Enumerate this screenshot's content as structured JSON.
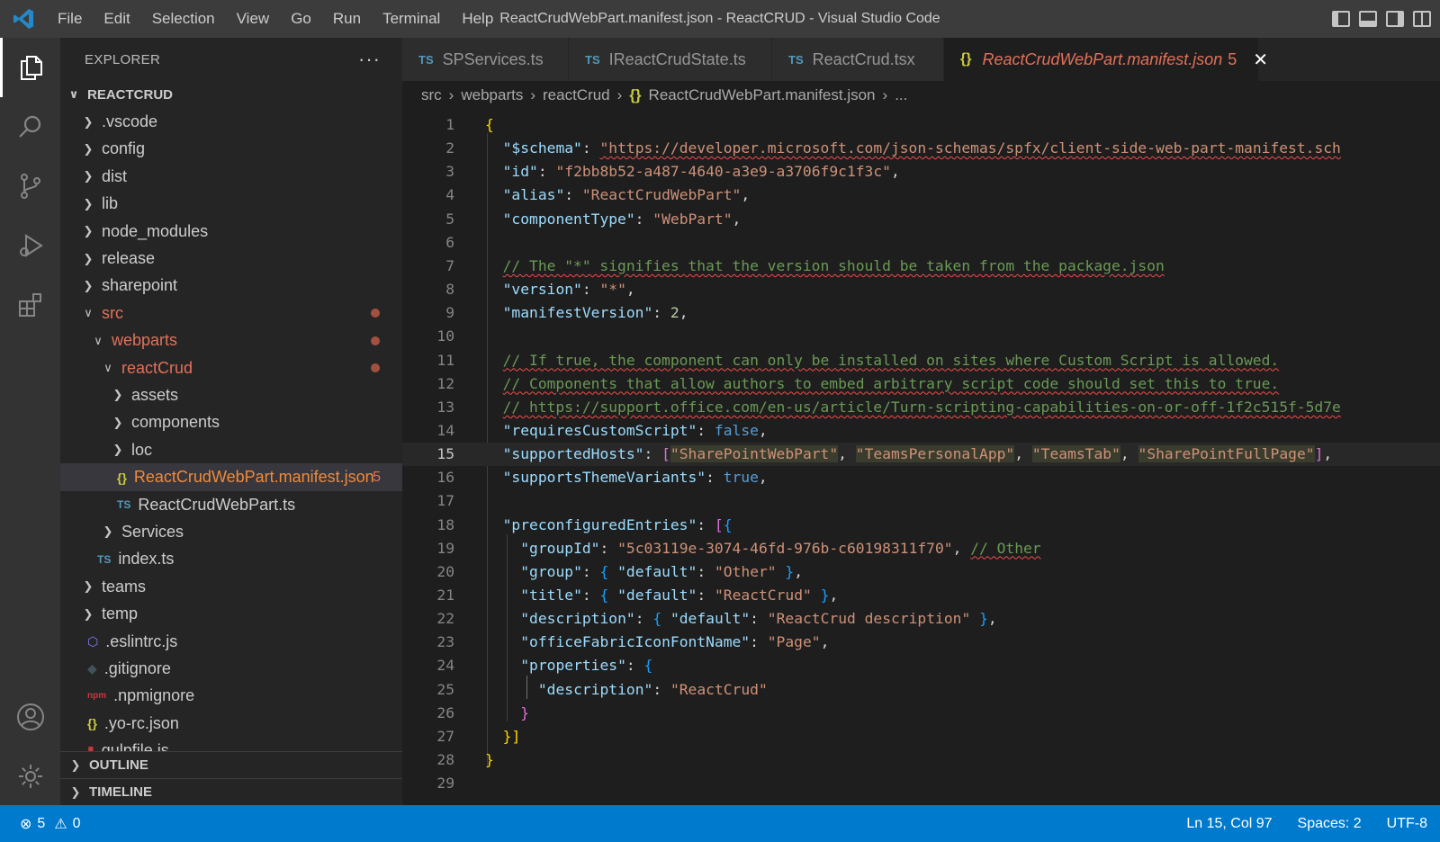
{
  "titlebar": {
    "menu": [
      "File",
      "Edit",
      "Selection",
      "View",
      "Go",
      "Run",
      "Terminal",
      "Help"
    ],
    "window_title": "ReactCrudWebPart.manifest.json - ReactCRUD - Visual Studio Code"
  },
  "activity_bar": [
    "explorer-icon",
    "search-icon",
    "source-control-icon",
    "run-debug-icon",
    "extensions-icon",
    "account-icon",
    "settings-gear-icon"
  ],
  "sidebar": {
    "title": "EXPLORER",
    "more": "···",
    "root": "REACTCRUD",
    "items": [
      {
        "label": ".vscode",
        "indent": 1,
        "type": "folder",
        "expanded": false
      },
      {
        "label": "config",
        "indent": 1,
        "type": "folder",
        "expanded": false
      },
      {
        "label": "dist",
        "indent": 1,
        "type": "folder",
        "expanded": false
      },
      {
        "label": "lib",
        "indent": 1,
        "type": "folder",
        "expanded": false
      },
      {
        "label": "node_modules",
        "indent": 1,
        "type": "folder",
        "expanded": false
      },
      {
        "label": "release",
        "indent": 1,
        "type": "folder",
        "expanded": false
      },
      {
        "label": "sharepoint",
        "indent": 1,
        "type": "folder",
        "expanded": false
      },
      {
        "label": "src",
        "indent": 1,
        "type": "folder",
        "expanded": true,
        "modified": true
      },
      {
        "label": "webparts",
        "indent": 2,
        "type": "folder",
        "expanded": true,
        "modified": true
      },
      {
        "label": "reactCrud",
        "indent": 3,
        "type": "folder",
        "expanded": true,
        "modified": true
      },
      {
        "label": "assets",
        "indent": 4,
        "type": "folder",
        "expanded": false
      },
      {
        "label": "components",
        "indent": 4,
        "type": "folder",
        "expanded": false
      },
      {
        "label": "loc",
        "indent": 4,
        "type": "folder",
        "expanded": false
      },
      {
        "label": "ReactCrudWebPart.manifest.json",
        "indent": 4,
        "type": "json",
        "selected": true,
        "badge": "5"
      },
      {
        "label": "ReactCrudWebPart.ts",
        "indent": 4,
        "type": "ts"
      },
      {
        "label": "Services",
        "indent": 3,
        "type": "folder",
        "expanded": false
      },
      {
        "label": "index.ts",
        "indent": 2,
        "type": "ts"
      },
      {
        "label": "teams",
        "indent": 1,
        "type": "folder",
        "expanded": false
      },
      {
        "label": "temp",
        "indent": 1,
        "type": "folder",
        "expanded": false
      },
      {
        "label": ".eslintrc.js",
        "indent": 1,
        "type": "eslint"
      },
      {
        "label": ".gitignore",
        "indent": 1,
        "type": "git"
      },
      {
        "label": ".npmignore",
        "indent": 1,
        "type": "npm"
      },
      {
        "label": ".yo-rc.json",
        "indent": 1,
        "type": "json"
      },
      {
        "label": "gulpfile.js",
        "indent": 1,
        "type": "gulp"
      }
    ],
    "outline": "OUTLINE",
    "timeline": "TIMELINE"
  },
  "tabs": [
    {
      "label": "SPServices.ts",
      "icon": "TS"
    },
    {
      "label": "IReactCrudState.ts",
      "icon": "TS"
    },
    {
      "label": "ReactCrud.tsx",
      "icon": "TS"
    },
    {
      "label": "ReactCrudWebPart.manifest.json",
      "icon": "{}",
      "badge": "5",
      "active": true
    }
  ],
  "breadcrumb": [
    "src",
    "webparts",
    "reactCrud",
    "ReactCrudWebPart.manifest.json",
    "..."
  ],
  "editor": {
    "current_line": 15,
    "lines": [
      "{",
      "  \"$schema\": \"https://developer.microsoft.com/json-schemas/spfx/client-side-web-part-manifest.sch",
      "  \"id\": \"f2bb8b52-a487-4640-a3e9-a3706f9c1f3c\",",
      "  \"alias\": \"ReactCrudWebPart\",",
      "  \"componentType\": \"WebPart\",",
      "",
      "  // The \"*\" signifies that the version should be taken from the package.json",
      "  \"version\": \"*\",",
      "  \"manifestVersion\": 2,",
      "",
      "  // If true, the component can only be installed on sites where Custom Script is allowed.",
      "  // Components that allow authors to embed arbitrary script code should set this to true.",
      "  // https://support.office.com/en-us/article/Turn-scripting-capabilities-on-or-off-1f2c515f-5d7e",
      "  \"requiresCustomScript\": false,",
      "  \"supportedHosts\": [\"SharePointWebPart\", \"TeamsPersonalApp\", \"TeamsTab\", \"SharePointFullPage\"],",
      "  \"supportsThemeVariants\": true,",
      "",
      "  \"preconfiguredEntries\": [{",
      "    \"groupId\": \"5c03119e-3074-46fd-976b-c60198311f70\", // Other",
      "    \"group\": { \"default\": \"Other\" },",
      "    \"title\": { \"default\": \"ReactCrud\" },",
      "    \"description\": { \"default\": \"ReactCrud description\" },",
      "    \"officeFabricIconFontName\": \"Page\",",
      "    \"properties\": {",
      "      \"description\": \"ReactCrud\"",
      "    }",
      "  }]",
      "}",
      ""
    ]
  },
  "statusbar": {
    "errors": "5",
    "warnings": "0",
    "position": "Ln 15, Col 97",
    "spaces": "Spaces: 2",
    "encoding": "UTF-8"
  },
  "colors": {
    "accent": "#007acc",
    "modified": "#e2705a",
    "json_icon": "#cbcb41",
    "ts_icon": "#519aba"
  }
}
